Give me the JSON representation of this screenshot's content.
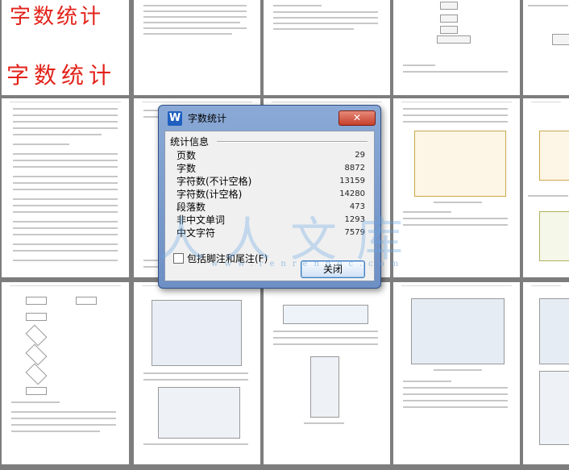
{
  "banner": {
    "title": "字数统计",
    "subtitle": "字数统计"
  },
  "dialog": {
    "title": "字数统计",
    "app_icon_letter": "W",
    "close_glyph": "✕",
    "section_label": "统计信息",
    "stats": [
      {
        "label": "页数",
        "value": "29"
      },
      {
        "label": "字数",
        "value": "8872"
      },
      {
        "label": "字符数(不计空格)",
        "value": "13159"
      },
      {
        "label": "字符数(计空格)",
        "value": "14280"
      },
      {
        "label": "段落数",
        "value": "473"
      },
      {
        "label": "非中文单词",
        "value": "1293"
      },
      {
        "label": "中文字符",
        "value": "7579"
      }
    ],
    "checkbox_label": "包括脚注和尾注(F)",
    "checkbox_checked": false,
    "close_button": "关闭"
  },
  "watermark": {
    "text": "人人文库",
    "url": "www.renrendoc.com"
  }
}
